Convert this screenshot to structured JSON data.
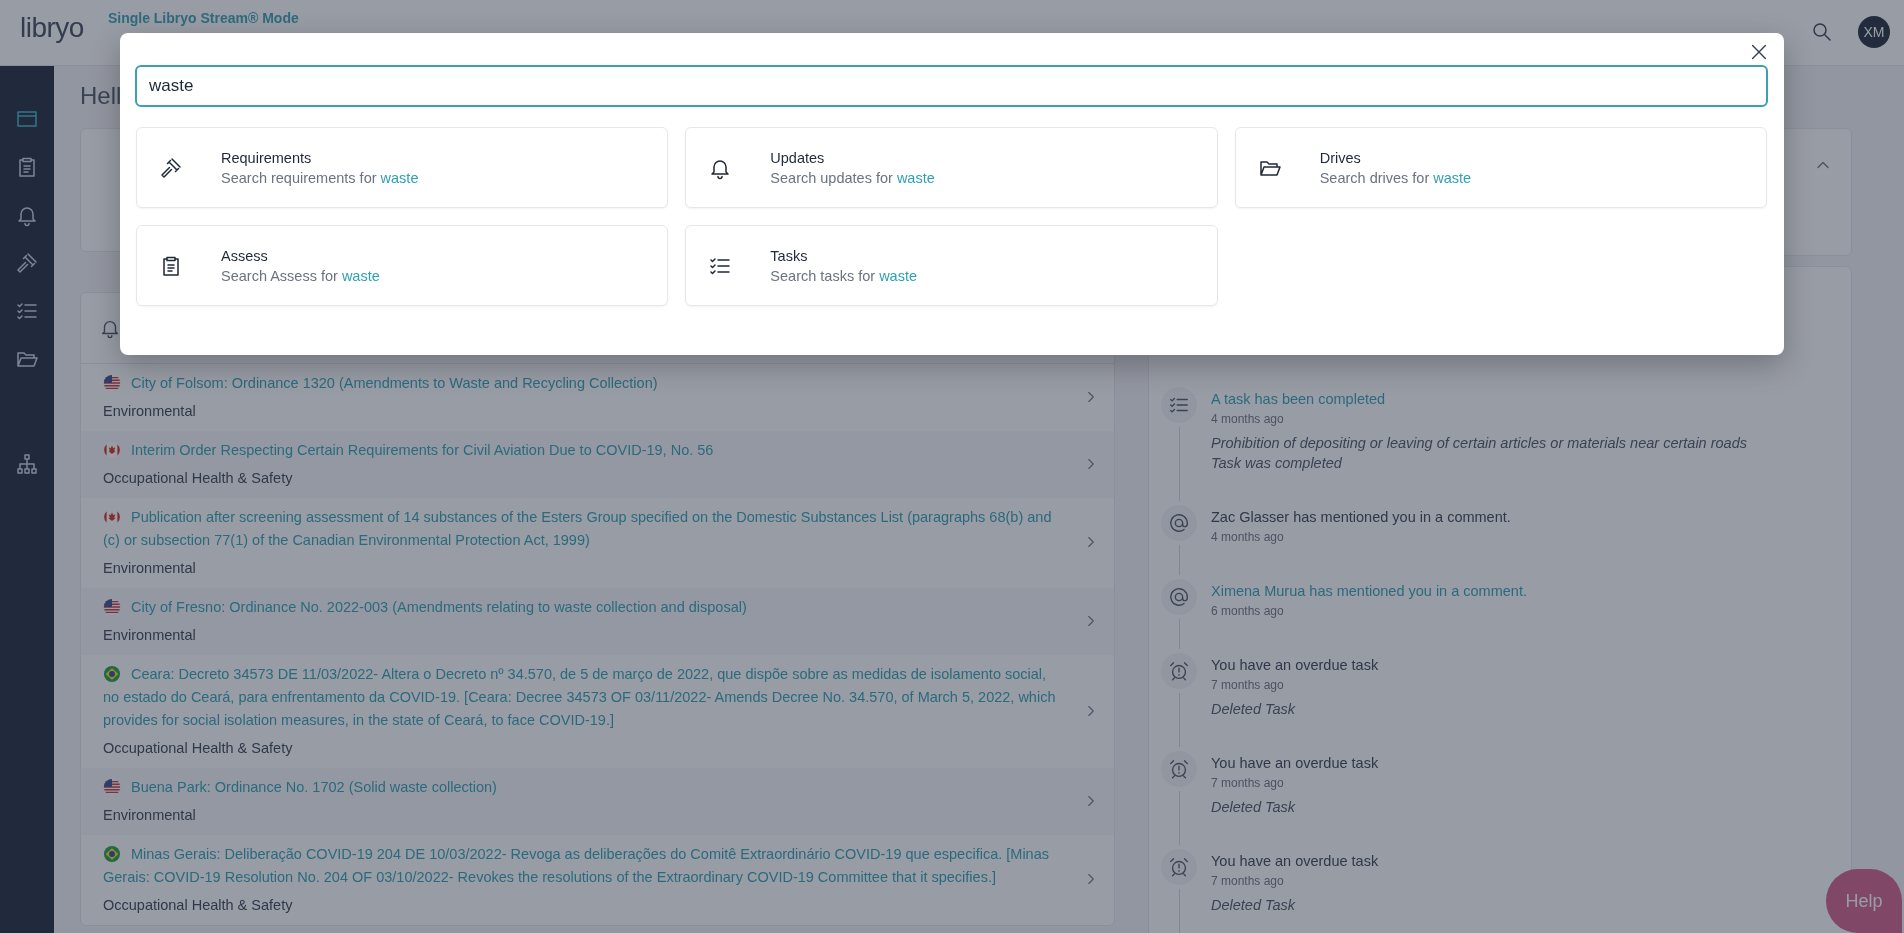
{
  "header": {
    "logo": "libryo",
    "mode_label": "Single Libryo Stream® Mode",
    "avatar_initials": "XM"
  },
  "sidebar": {
    "items": [
      {
        "selected": true
      },
      {
        "selected": false
      },
      {
        "selected": false
      },
      {
        "selected": false
      },
      {
        "selected": false
      },
      {
        "selected": false
      },
      {
        "selected": false
      }
    ]
  },
  "page": {
    "heading": "Hell"
  },
  "updates_feed": {
    "items": [
      {
        "kind": "us",
        "title": "City of Folsom: Ordinance 1320 (Amendments to Waste and Recycling Collection)",
        "category": "Environmental"
      },
      {
        "kind": "ca",
        "title": "Interim Order Respecting Certain Requirements for Civil Aviation Due to COVID-19, No. 56",
        "category": "Occupational Health & Safety"
      },
      {
        "kind": "ca",
        "title": "Publication after screening assessment of 14 substances of the Esters Group specified on the Domestic Substances List (paragraphs 68(b) and (c) or subsection 77(1) of the Canadian Environmental Protection Act, 1999)",
        "category": "Environmental"
      },
      {
        "kind": "us",
        "title": "City of Fresno: Ordinance No. 2022-003 (Amendments relating to waste collection and disposal)",
        "category": "Environmental"
      },
      {
        "kind": "br",
        "title": "Ceara: Decreto 34573 DE 11/03/2022- Altera o Decreto nº 34.570, de 5 de março de 2022, que dispõe sobre as medidas de isolamento social, no estado do Ceará, para enfrentamento da COVID-19. [Ceara: Decree 34573 OF 03/11/2022- Amends Decree No. 34.570, of March 5, 2022, which provides for social isolation measures, in the state of Ceará, to face COVID-19.]",
        "category": "Occupational Health & Safety"
      },
      {
        "kind": "us",
        "title": "Buena Park: Ordinance No. 1702 (Solid waste collection)",
        "category": "Environmental"
      },
      {
        "kind": "br",
        "title": "Minas Gerais: Deliberação COVID-19 204 DE 10/03/2022- Revoga as deliberações do Comitê Extraordinário COVID-19 que especifica. [Minas Gerais: COVID-19 Resolution No. 204 OF 03/10/2022- Revokes the resolutions of the Extraordinary COVID-19 Committee that it specifies.]",
        "category": "Occupational Health & Safety"
      }
    ]
  },
  "activity": {
    "items": [
      {
        "kind": "task",
        "title": "A task has been completed",
        "highlighted": true,
        "time": "4 months ago",
        "details": [
          "Prohibition of depositing or leaving of certain articles or materials near certain roads",
          "Task was completed"
        ]
      },
      {
        "kind": "mention",
        "title": "Zac Glasser has mentioned you in a comment.",
        "highlighted": false,
        "time": "4 months ago"
      },
      {
        "kind": "mention",
        "title": "Ximena Murua has mentioned you in a comment.",
        "highlighted": true,
        "time": "6 months ago"
      },
      {
        "kind": "overdue",
        "title": "You have an overdue task",
        "highlighted": false,
        "time": "7 months ago",
        "details": [
          "Deleted Task"
        ]
      },
      {
        "kind": "overdue",
        "title": "You have an overdue task",
        "highlighted": false,
        "time": "7 months ago",
        "details": [
          "Deleted Task"
        ]
      },
      {
        "kind": "overdue",
        "title": "You have an overdue task",
        "highlighted": false,
        "time": "7 months ago",
        "details": [
          "Deleted Task"
        ]
      }
    ]
  },
  "help_button": "Help",
  "search_modal": {
    "query": "waste",
    "results": [
      {
        "title": "Requirements",
        "description": "Search requirements for",
        "term": "waste"
      },
      {
        "title": "Updates",
        "description": "Search updates for",
        "term": "waste"
      },
      {
        "title": "Drives",
        "description": "Search drives for",
        "term": "waste"
      },
      {
        "title": "Assess",
        "description": "Search Assess for",
        "term": "waste"
      },
      {
        "title": "Tasks",
        "description": "Search tasks for",
        "term": "waste"
      }
    ]
  }
}
